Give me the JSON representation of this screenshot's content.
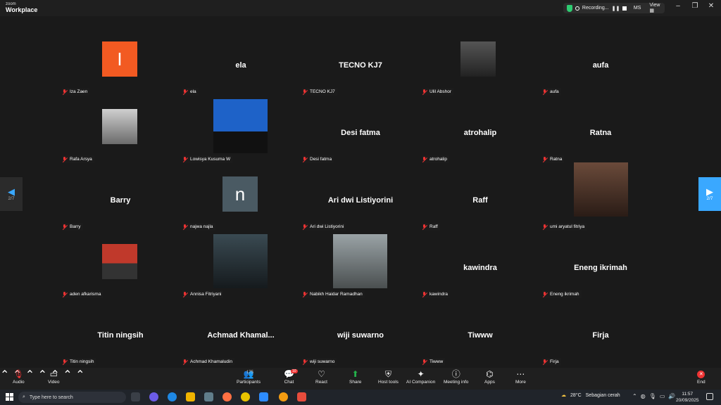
{
  "window": {
    "brand_top": "zoom",
    "brand_bottom": "Workplace",
    "recording_label": "Recording...",
    "user_initials": "MS",
    "view_label": "View",
    "minimize_icon": "minimize-icon",
    "maximize_icon": "restore-icon",
    "close_icon": "close-icon"
  },
  "pager": {
    "left_label": "2/7",
    "right_label": "2/7"
  },
  "tiles": [
    {
      "name": "Iza Zaen",
      "center": "",
      "kind": "letter",
      "letter": "I",
      "color": "#f25a22"
    },
    {
      "name": "ela",
      "center": "ela",
      "kind": "text"
    },
    {
      "name": "TECNO KJ7",
      "center": "TECNO KJ7",
      "kind": "text"
    },
    {
      "name": "Ulil Abshor",
      "center": "",
      "kind": "photo"
    },
    {
      "name": "aufa",
      "center": "aufa",
      "kind": "text"
    },
    {
      "name": "Rafa Arsya",
      "center": "",
      "kind": "photo"
    },
    {
      "name": "Lowisya Kusuma W",
      "center": "",
      "kind": "photo"
    },
    {
      "name": "Desi fatma",
      "center": "Desi fatma",
      "kind": "text"
    },
    {
      "name": "atrohalip",
      "center": "atrohalip",
      "kind": "text"
    },
    {
      "name": "Ratna",
      "center": "Ratna",
      "kind": "text"
    },
    {
      "name": "Barry",
      "center": "Barry",
      "kind": "text"
    },
    {
      "name": "najwa najla",
      "center": "",
      "kind": "letter",
      "letter": "n",
      "color": "#4a5a63"
    },
    {
      "name": "Ari dwi Listiyorini",
      "center": "Ari dwi Listiyorini",
      "kind": "text"
    },
    {
      "name": "Raff",
      "center": "Raff",
      "kind": "text"
    },
    {
      "name": "umi aryatul fitriya",
      "center": "",
      "kind": "photo"
    },
    {
      "name": "aden afkarisma",
      "center": "",
      "kind": "photo"
    },
    {
      "name": "Annisa Fitriyani",
      "center": "",
      "kind": "photo"
    },
    {
      "name": "Nabikh Haidar Ramadhan",
      "center": "",
      "kind": "photo"
    },
    {
      "name": "kawindra",
      "center": "kawindra",
      "kind": "text"
    },
    {
      "name": "Eneng ikrimah",
      "center": "Eneng ikrimah",
      "kind": "text"
    },
    {
      "name": "Titin ningsih",
      "center": "Titin ningsih",
      "kind": "text"
    },
    {
      "name": "Achmad Khamaludin",
      "center": "Achmad  Khamal...",
      "kind": "text"
    },
    {
      "name": "wiji suwarno",
      "center": "wiji suwarno",
      "kind": "text"
    },
    {
      "name": "Tiwww",
      "center": "Tiwww",
      "kind": "text"
    },
    {
      "name": "Firja",
      "center": "Firja",
      "kind": "text"
    }
  ],
  "toolbar": {
    "audio": "Audio",
    "video": "Video",
    "participants": "Participants",
    "participants_count": "175",
    "chat": "Chat",
    "chat_badge": "10",
    "react": "React",
    "share": "Share",
    "host_tools": "Host tools",
    "ai_companion": "AI Companion",
    "meeting_info": "Meeting info",
    "apps": "Apps",
    "more": "More",
    "end": "End"
  },
  "taskbar": {
    "search_placeholder": "Type here to search",
    "weather_temp": "28°C",
    "weather_desc": "Sebagian cerah",
    "time": "11:57",
    "date": "20/09/2025"
  },
  "colors": {
    "accent_blue": "#3aa8ff",
    "muted_red": "#e33",
    "share_green": "#24b24b"
  }
}
